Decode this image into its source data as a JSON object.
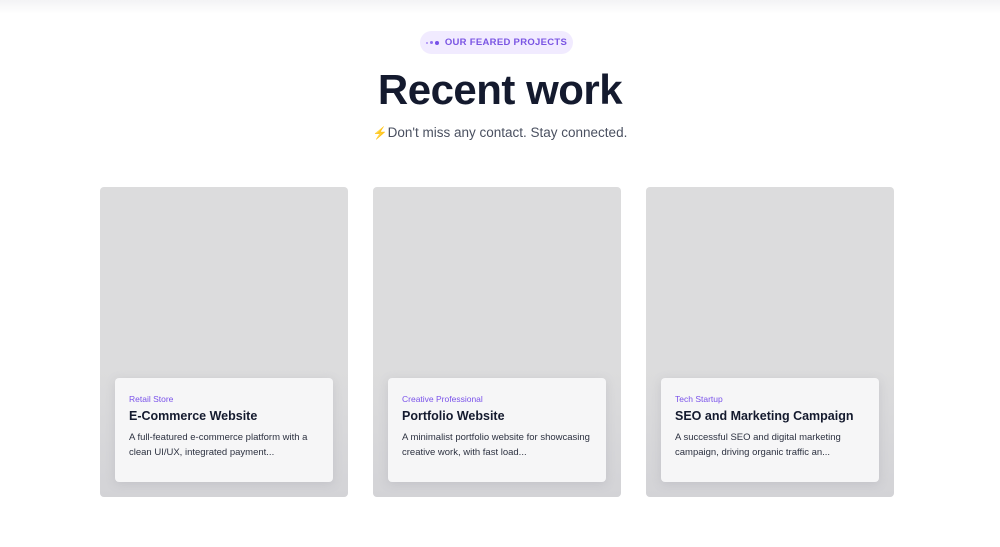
{
  "section": {
    "badge_label": "OUR FEARED PROJECTS",
    "badge_icon": "dots-icon",
    "title": "Recent work",
    "subtitle_icon": "lightning-icon",
    "subtitle_emoji": "⚡",
    "subtitle": "Don't miss any contact. Stay connected."
  },
  "projects": [
    {
      "category": "Retail Store",
      "title": "E-Commerce Website",
      "description": "A full-featured e-commerce platform with a clean UI/UX, integrated payment..."
    },
    {
      "category": "Creative Professional",
      "title": "Portfolio Website",
      "description": "A minimalist portfolio website for showcasing creative work, with fast load..."
    },
    {
      "category": "Tech Startup",
      "title": "SEO and Marketing Campaign",
      "description": "A successful SEO and digital marketing campaign, driving organic traffic an..."
    }
  ],
  "colors": {
    "accent": "#7a55e3",
    "badge_bg": "#f1ebff",
    "heading": "#141a2e",
    "card_bg": "#dcdcdd",
    "card_info_bg": "#f6f6f7",
    "bolt": "#f5b71f"
  }
}
